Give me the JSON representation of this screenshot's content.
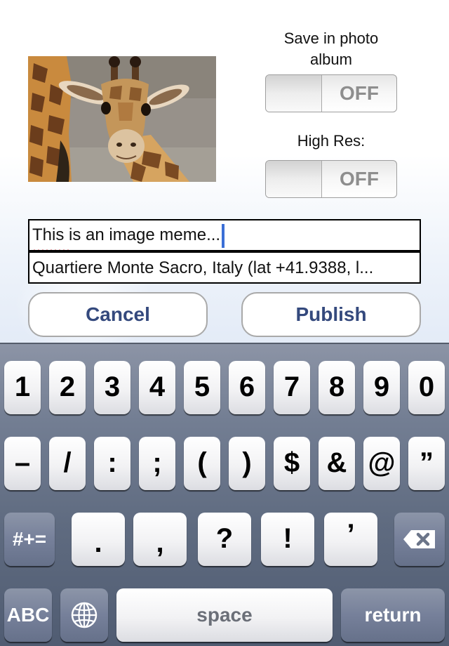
{
  "compose": {
    "save_in_album_label": "Save in photo album",
    "save_in_album_state": "OFF",
    "high_res_label": "High Res:",
    "high_res_state": "OFF",
    "caption_value": "This is an image meme...",
    "location_value": "Quartiere Monte Sacro, Italy (lat +41.9388, l...",
    "cancel_label": "Cancel",
    "publish_label": "Publish"
  },
  "keyboard": {
    "row1": [
      "1",
      "2",
      "3",
      "4",
      "5",
      "6",
      "7",
      "8",
      "9",
      "0"
    ],
    "row2": [
      "–",
      "/",
      ":",
      ";",
      "(",
      ")",
      "$",
      "&",
      "@",
      "”"
    ],
    "row3": [
      ".",
      ",",
      "?",
      "!",
      "’"
    ],
    "shift_label": "#+=",
    "abc_label": "ABC",
    "space_label": "space",
    "return_label": "return",
    "globe_icon": "globe-icon",
    "delete_icon": "backspace-icon"
  },
  "colors": {
    "button_text": "#34497d",
    "caret": "#3b6fd6",
    "keyboard_bg": "#66718a"
  }
}
